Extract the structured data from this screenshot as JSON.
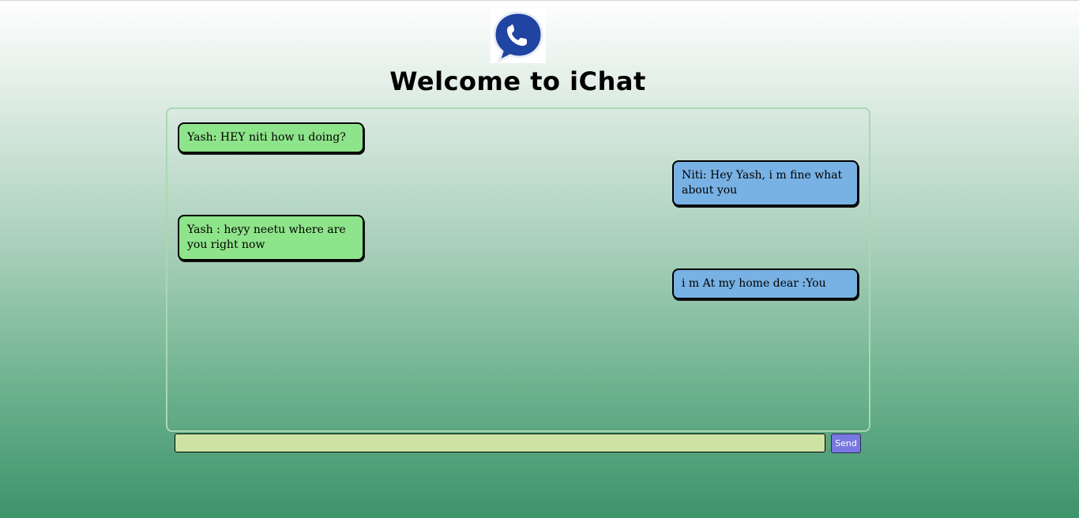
{
  "header": {
    "title": "Welcome to iChat",
    "logo_icon": "phone-chat-bubble-icon",
    "logo_color": "#1f44a2"
  },
  "messages": [
    {
      "side": "left",
      "text": "Yash: HEY niti how u doing?"
    },
    {
      "side": "right",
      "text": "Niti: Hey Yash, i m fine what about you"
    },
    {
      "side": "left",
      "text": "Yash : heyy neetu where are you right now"
    },
    {
      "side": "right",
      "text": "i m At my home dear :You"
    }
  ],
  "composer": {
    "value": "",
    "placeholder": "",
    "send_label": "Send"
  },
  "colors": {
    "incoming_bubble": "#8ee48a",
    "outgoing_bubble": "#78b1e3",
    "input_bg": "#cde3a4",
    "send_bg": "#7878e0"
  }
}
